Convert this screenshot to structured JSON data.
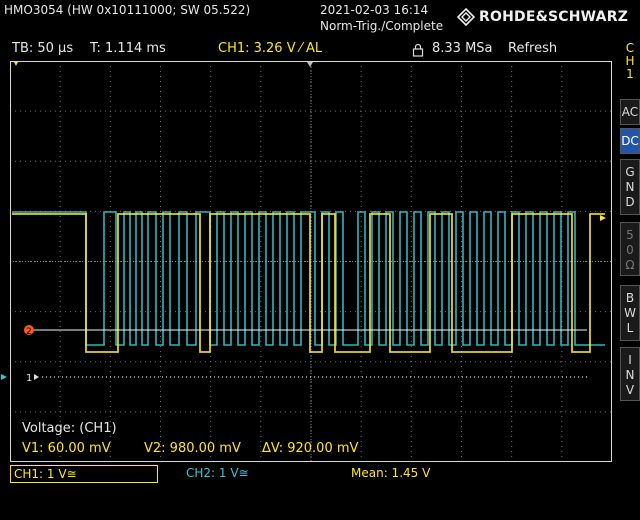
{
  "header": {
    "model": "HMO3054 (HW 0x10111000; SW 05.522)",
    "datetime": "2021-02-03 16:14",
    "trigger_state": "Norm-Trig./Complete",
    "brand": "ROHDE&SCHWARZ",
    "logo_icon": "rohde-schwarz-diamond-icon"
  },
  "status": {
    "timebase": "TB: 50 µs",
    "trigger_time": "T: 1.114 ms",
    "ch1_trigger": "CH1: 3.26 V ⁄ AL",
    "sample_rate": "8.33 MSa",
    "acq_mode": "Refresh",
    "lock_icon": "lock-icon"
  },
  "side_menu": {
    "channel": [
      "C",
      "H",
      "1"
    ],
    "items": [
      {
        "label": "AC",
        "selected": false
      },
      {
        "label": "DC",
        "selected": true
      },
      {
        "label": "GND",
        "selected": false
      },
      {
        "label": "50Ω",
        "selected": false
      },
      {
        "label": "BWL",
        "selected": false
      },
      {
        "label": "INV",
        "selected": false
      }
    ]
  },
  "cursors": {
    "title": "Voltage: (CH1)",
    "v1": "V1: 60.00 mV",
    "v2": "V2: 980.00 mV",
    "dv": "ΔV: 920.00 mV"
  },
  "footer": {
    "ch1": "CH1: 1 V≅",
    "ch2": "CH2: 1 V≅",
    "mean": "Mean: 1.45 V"
  },
  "markers": {
    "cursor_marker": "2",
    "ground_marker": "1"
  },
  "colors": {
    "ch1": "#ffe62a",
    "ch2": "#39c6d4",
    "grid": "#6e6e6e",
    "background": "#000000",
    "cursor_marker": "#ff5a1a"
  }
}
